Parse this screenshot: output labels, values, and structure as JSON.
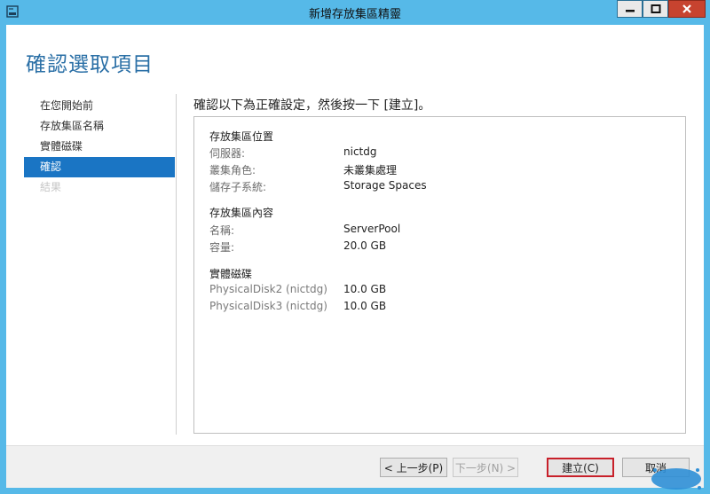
{
  "window": {
    "title": "新增存放集區精靈",
    "controls": {
      "minimize_icon": "minimize-icon",
      "maximize_icon": "maximize-icon",
      "close_icon": "close-icon"
    }
  },
  "page_title": "確認選取項目",
  "nav": {
    "items": [
      {
        "label": "在您開始前",
        "state": "normal"
      },
      {
        "label": "存放集區名稱",
        "state": "normal"
      },
      {
        "label": "實體磁碟",
        "state": "normal"
      },
      {
        "label": "確認",
        "state": "active"
      },
      {
        "label": "結果",
        "state": "disabled"
      }
    ]
  },
  "instruction": "確認以下為正確設定，然後按一下 [建立]。",
  "summary": {
    "location": {
      "title": "存放集區位置",
      "rows": [
        {
          "key": "伺服器:",
          "value": "nictdg"
        },
        {
          "key": "叢集角色:",
          "value": "未叢集處理"
        },
        {
          "key": "儲存子系統:",
          "value": "Storage Spaces"
        }
      ]
    },
    "properties": {
      "title": "存放集區內容",
      "rows": [
        {
          "key": "名稱:",
          "value": "ServerPool"
        },
        {
          "key": "容量:",
          "value": "20.0 GB"
        }
      ]
    },
    "disks": {
      "title": "實體磁碟",
      "rows": [
        {
          "key": "PhysicalDisk2 (nictdg)",
          "value": "10.0 GB"
        },
        {
          "key": "PhysicalDisk3 (nictdg)",
          "value": "10.0 GB"
        }
      ]
    }
  },
  "buttons": {
    "previous": "< 上一步(P)",
    "next": "下一步(N) >",
    "create": "建立(C)",
    "cancel": "取消"
  },
  "colors": {
    "window_frame": "#56b9e8",
    "title_accent": "#2a6fa6",
    "nav_active": "#1a75c4",
    "close_button": "#c7432f",
    "focus_border": "#c8202a"
  }
}
